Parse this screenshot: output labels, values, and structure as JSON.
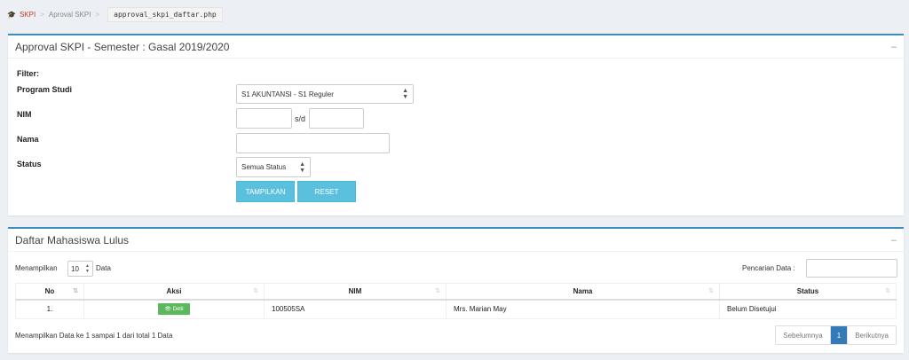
{
  "breadcrumb": {
    "home": "SKPI",
    "section": "Aproval SKPI",
    "current": "approval_skpi_daftar.php"
  },
  "filter_box": {
    "title": "Approval SKPI - Semester : Gasal 2019/2020",
    "filter_label": "Filter:",
    "program_studi_label": "Program Studi",
    "program_studi_value": "S1 AKUNTANSI - S1 Reguler",
    "nim_label": "NIM",
    "nim_from": "",
    "nim_sd": "s/d",
    "nim_to": "",
    "nama_label": "Nama",
    "nama_value": "",
    "status_label": "Status",
    "status_value": "Semua Status",
    "show_button": "TAMPILKAN",
    "reset_button": "RESET"
  },
  "list_box": {
    "title": "Daftar Mahasiswa Lulus",
    "show_prefix": "Menampilkan",
    "page_length": "10",
    "show_suffix": "Data",
    "search_label": "Pencarian Data :",
    "search_value": "",
    "columns": [
      "No",
      "Aksi",
      "NIM",
      "Nama",
      "Status"
    ],
    "rows": [
      {
        "no": "1.",
        "action": "Detil",
        "nim": "100505SA",
        "nama": "Mrs. Marian May",
        "status": "Belum Disetujui"
      }
    ],
    "info": "Menampilkan Data ke 1 sampai 1 dari total 1 Data",
    "pagination": {
      "prev": "Sebelumnya",
      "page": "1",
      "next": "Berikutnya"
    }
  },
  "colors": {
    "accent": "#3c8dbc",
    "info_button": "#5bc0de",
    "success_button": "#5cb85c",
    "danger_text": "#d9534f",
    "page_active": "#337ab7"
  },
  "icons": {
    "home": "graduation-cap-icon",
    "collapse": "minus-icon",
    "detail": "eye-icon",
    "sort": "sort-icon"
  }
}
